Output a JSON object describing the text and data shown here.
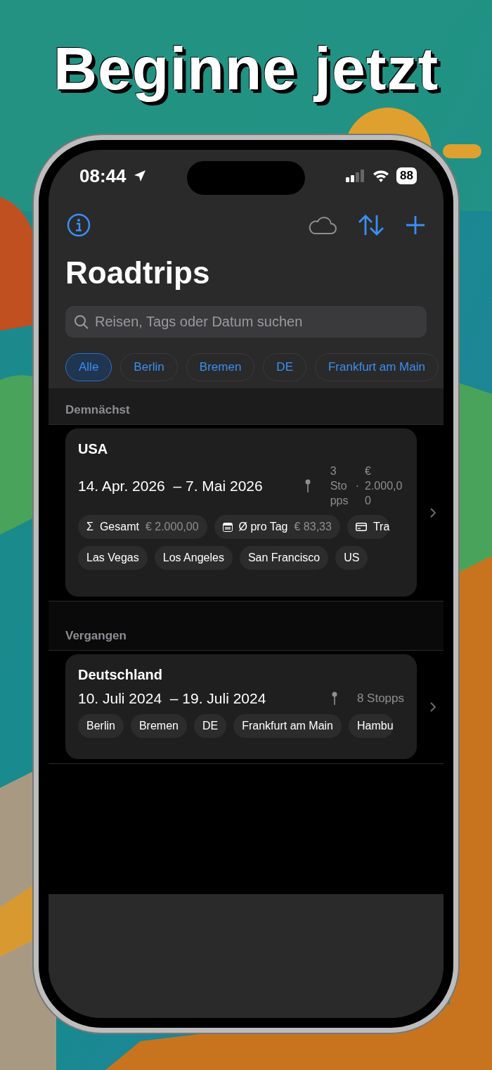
{
  "headline": "Beginne jetzt",
  "status_bar": {
    "time": "08:44",
    "battery": "88"
  },
  "title": "Roadtrips",
  "search": {
    "placeholder": "Reisen, Tags oder Datum suchen"
  },
  "filters": [
    {
      "label": "Alle",
      "selected": true
    },
    {
      "label": "Berlin",
      "selected": false
    },
    {
      "label": "Bremen",
      "selected": false
    },
    {
      "label": "DE",
      "selected": false
    },
    {
      "label": "Frankfurt am Main",
      "selected": false
    }
  ],
  "sections": [
    {
      "title": "Demnächst",
      "trips": [
        {
          "name": "USA",
          "dates": "14. Apr. 2026  – 7. Mai 2026",
          "stops": "3 Stopps",
          "separator": "·",
          "cost": "€ 2.000,00",
          "stats": [
            {
              "kind": "total",
              "symbol": "Σ",
              "label": "Gesamt",
              "value": "€ 2.000,00"
            },
            {
              "kind": "per_day",
              "label": "Ø pro Tag",
              "value": "€ 83,33"
            },
            {
              "kind": "card",
              "label": "Tra"
            }
          ],
          "tags": [
            "Las Vegas",
            "Los Angeles",
            "San Francisco",
            "US"
          ]
        }
      ]
    },
    {
      "title": "Vergangen",
      "trips": [
        {
          "name": "Deutschland",
          "dates": "10. Juli 2024  – 19. Juli 2024",
          "stops": "8 Stopps",
          "tags": [
            "Berlin",
            "Bremen",
            "DE",
            "Frankfurt am Main",
            "Hambu"
          ]
        }
      ]
    }
  ]
}
